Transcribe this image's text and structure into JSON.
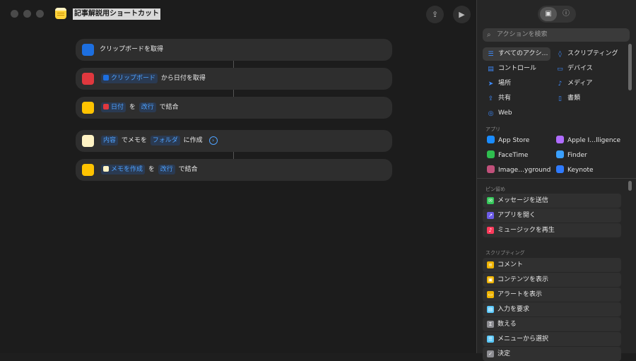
{
  "window": {
    "title": "記事解説用ショートカット"
  },
  "toolbar": {
    "share_icon": "share-icon",
    "run_icon": "play-icon"
  },
  "actions": [
    {
      "parts": [
        {
          "text": "クリップボードを取得"
        }
      ]
    },
    {
      "token1": "クリップボード",
      "text1": "から日付を取得"
    },
    {
      "token1": "日付",
      "text1": "を",
      "token2": "改行",
      "text2": "で結合"
    },
    {
      "token1": "内容",
      "text1": "でメモを",
      "token2": "フォルダ",
      "text2": "に作成"
    },
    {
      "token1": "メモを作成",
      "text1": "を",
      "token2": "改行",
      "text2": "で結合"
    }
  ],
  "sidebar": {
    "search_placeholder": "アクションを検索",
    "categories": [
      {
        "label": "すべてのアクシ…",
        "icon": "☰"
      },
      {
        "label": "スクリプティング",
        "icon": "◊"
      },
      {
        "label": "コントロール",
        "icon": "▤"
      },
      {
        "label": "デバイス",
        "icon": "▭"
      },
      {
        "label": "場所",
        "icon": "➤"
      },
      {
        "label": "メディア",
        "icon": "♪"
      },
      {
        "label": "共有",
        "icon": "⇪"
      },
      {
        "label": "書類",
        "icon": "▯"
      },
      {
        "label": "Web",
        "icon": "◎"
      }
    ],
    "apps_label": "アプリ",
    "apps": [
      {
        "label": "App Store",
        "color": "#1a8cff"
      },
      {
        "label": "Apple I…lligence",
        "color": "#b06cff"
      },
      {
        "label": "FaceTime",
        "color": "#2fbe4f"
      },
      {
        "label": "Finder",
        "color": "#3aa0ff"
      },
      {
        "label": "Image…yground",
        "color": "#c0507a"
      },
      {
        "label": "Keynote",
        "color": "#2f7bff"
      }
    ],
    "pinned_label": "ピン留め",
    "pinned": [
      {
        "label": "メッセージを送信",
        "color": "#34c759",
        "glyph": "✉"
      },
      {
        "label": "アプリを開く",
        "color": "#6c5ce7",
        "glyph": "↗"
      },
      {
        "label": "ミュージックを再生",
        "color": "#ff3b5c",
        "glyph": "♪"
      }
    ],
    "scripting_label": "スクリプティング",
    "scripting": [
      {
        "label": "コメント",
        "color": "#f0b400",
        "glyph": "≡"
      },
      {
        "label": "コンテンツを表示",
        "color": "#f0b400",
        "glyph": "▣"
      },
      {
        "label": "アラートを表示",
        "color": "#f0b400",
        "glyph": "▭"
      },
      {
        "label": "入力を要求",
        "color": "#5ac8fa",
        "glyph": "▤"
      },
      {
        "label": "数える",
        "color": "#8e8e93",
        "glyph": "Σ"
      },
      {
        "label": "メニューから選択",
        "color": "#5ac8fa",
        "glyph": "☰"
      },
      {
        "label": "決定",
        "color": "#8e8e93",
        "glyph": "✓"
      }
    ]
  }
}
